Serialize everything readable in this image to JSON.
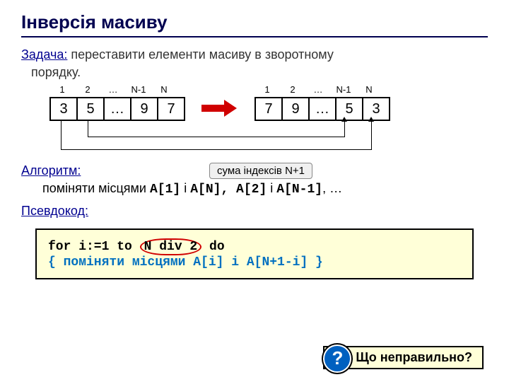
{
  "title": "Інверсія масиву",
  "task_label": "Задача:",
  "task_text1": " переставити елементи масиву в зворотному",
  "task_text2": "порядку.",
  "indices": [
    "1",
    "2",
    "…",
    "N-1",
    "N"
  ],
  "array_a": [
    "3",
    "5",
    "…",
    "9",
    "7"
  ],
  "array_b": [
    "7",
    "9",
    "…",
    "5",
    "3"
  ],
  "algo_label": "Алгоритм:",
  "note_text": "сума індексів N+1",
  "algo_pre": "поміняти місцями ",
  "algo_m1": "A[1]",
  "algo_and1": " і ",
  "algo_m2": "A[N]",
  "algo_sep": ", ",
  "algo_m3": "A[2]",
  "algo_and2": " і ",
  "algo_m4": "A[N-1]",
  "algo_suffix": ", …",
  "pseudo_label": "Псевдокод:",
  "code_for": "for i:=1 to ",
  "code_cond": "N div 2",
  "code_do": " do",
  "code_body": " { поміняти місцями A[i] i A[N+1-i] }",
  "question_text": "Що неправильно?",
  "qmark": "?"
}
